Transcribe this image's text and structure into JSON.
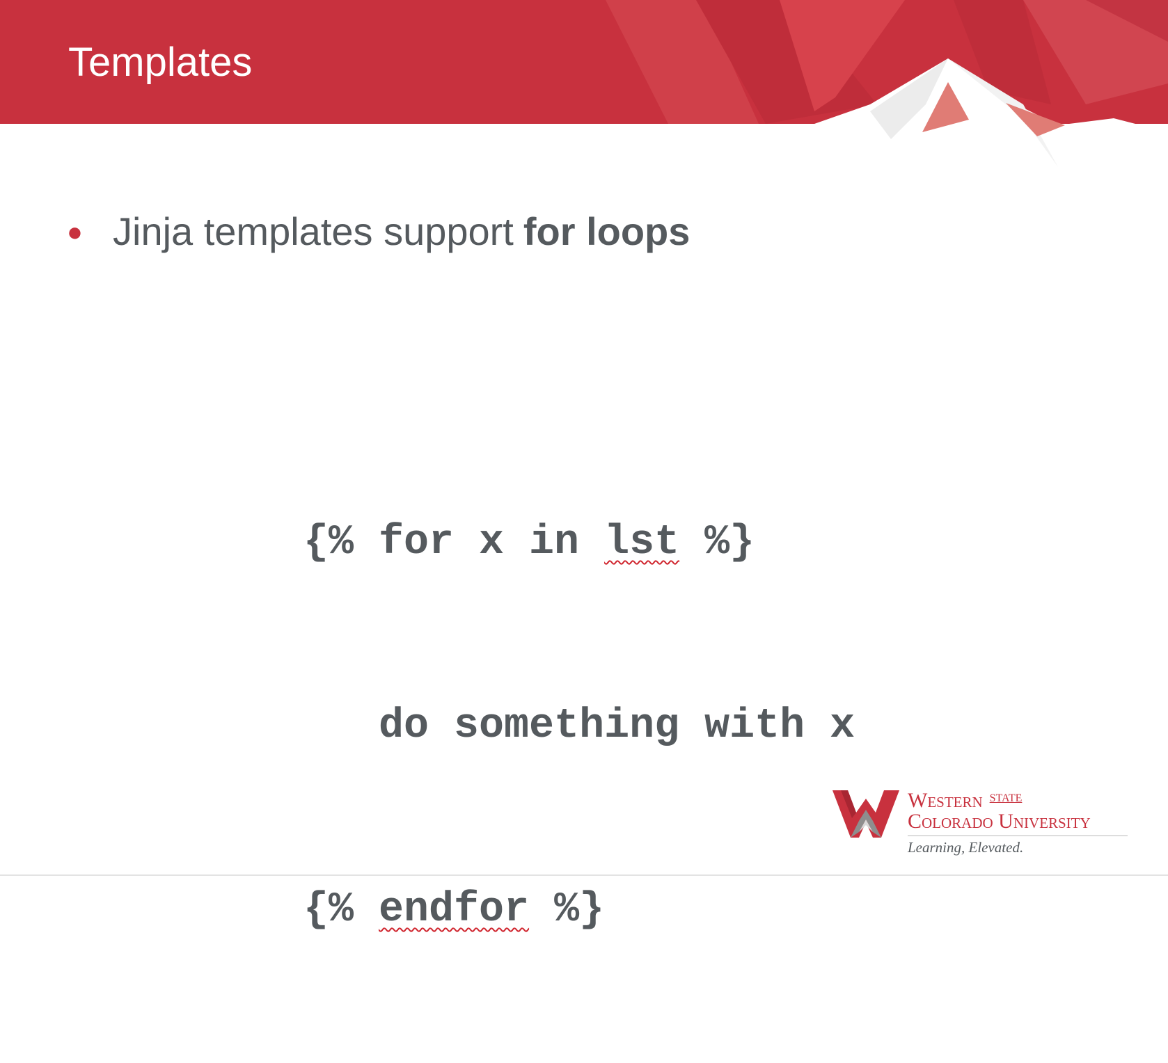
{
  "slide": {
    "title": "Templates",
    "bullets": [
      {
        "text": "Jinja templates support",
        "bold_text": "for loops"
      }
    ],
    "code": {
      "line1_start": "{% for x in ",
      "line1_spell": "lst",
      "line1_end": " %}",
      "line2": "   do something with x",
      "line3_start": "{% ",
      "line3_spell": "endfor",
      "line3_end": " %}"
    }
  },
  "logo": {
    "name_line1": "Western",
    "name_state": "STATE",
    "name_line2": "Colorado University",
    "tagline": "Learning, Elevated."
  },
  "colors": {
    "brand_red": "#c8313e",
    "text_gray": "#555a5e",
    "background": "#ffffff"
  },
  "icons": {
    "bullet": "bullet-dot",
    "logo_mark": "w-mountain-logo"
  }
}
